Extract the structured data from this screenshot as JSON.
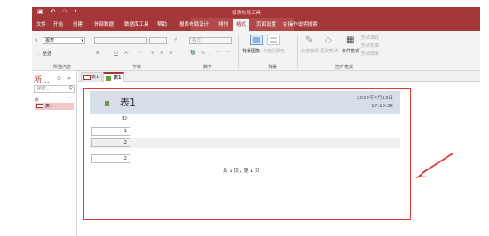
{
  "titlebar": {
    "context_title": "报表布局工具",
    "qat": [
      "save-icon",
      "undo-icon",
      "redo-icon",
      "customize-icon"
    ]
  },
  "tabs": [
    {
      "label": "文件"
    },
    {
      "label": "开始"
    },
    {
      "label": "创建"
    },
    {
      "label": "外部数据"
    },
    {
      "label": "数据库工具"
    },
    {
      "label": "帮助"
    },
    {
      "label": "报表布局设计"
    },
    {
      "label": "排列"
    },
    {
      "label": "格式",
      "active": true
    },
    {
      "label": "页面设置"
    },
    {
      "label": "操作说明搜索"
    }
  ],
  "ribbon": {
    "selection": {
      "label": "所选内容",
      "object": "报表",
      "select_all": "全选"
    },
    "font": {
      "label": "字体",
      "bold": "B",
      "italic": "I",
      "underline": "U"
    },
    "number": {
      "label": "数字",
      "format": "格式",
      "percent": "%"
    },
    "background": {
      "label": "背景",
      "bg_image": "背景图像",
      "alt_row": "可选行颜色"
    },
    "control_format": {
      "label": "控件格式",
      "quick_styles": "快速样式",
      "change_shape": "更改形状",
      "conditional": "条件格式",
      "shape_fill": "形状填充",
      "shape_outline": "形状轮廓",
      "shape_effects": "形状效果"
    }
  },
  "nav": {
    "title": "所...",
    "search_placeholder": "搜索...",
    "group": "表",
    "items": [
      {
        "label": "表1"
      }
    ]
  },
  "doc_tabs": [
    {
      "label": "表1"
    },
    {
      "label": "表1",
      "active": true
    }
  ],
  "report": {
    "title": "表1",
    "date": "2022年7月13日",
    "time": "17:19:26",
    "column": "ID",
    "rows": [
      "1",
      "2",
      "2"
    ],
    "footer": "共 1 页，第 1 页"
  },
  "colors": {
    "brand": "#a4373a",
    "header_band": "#d8dee9",
    "highlight": "#e23a3a"
  }
}
